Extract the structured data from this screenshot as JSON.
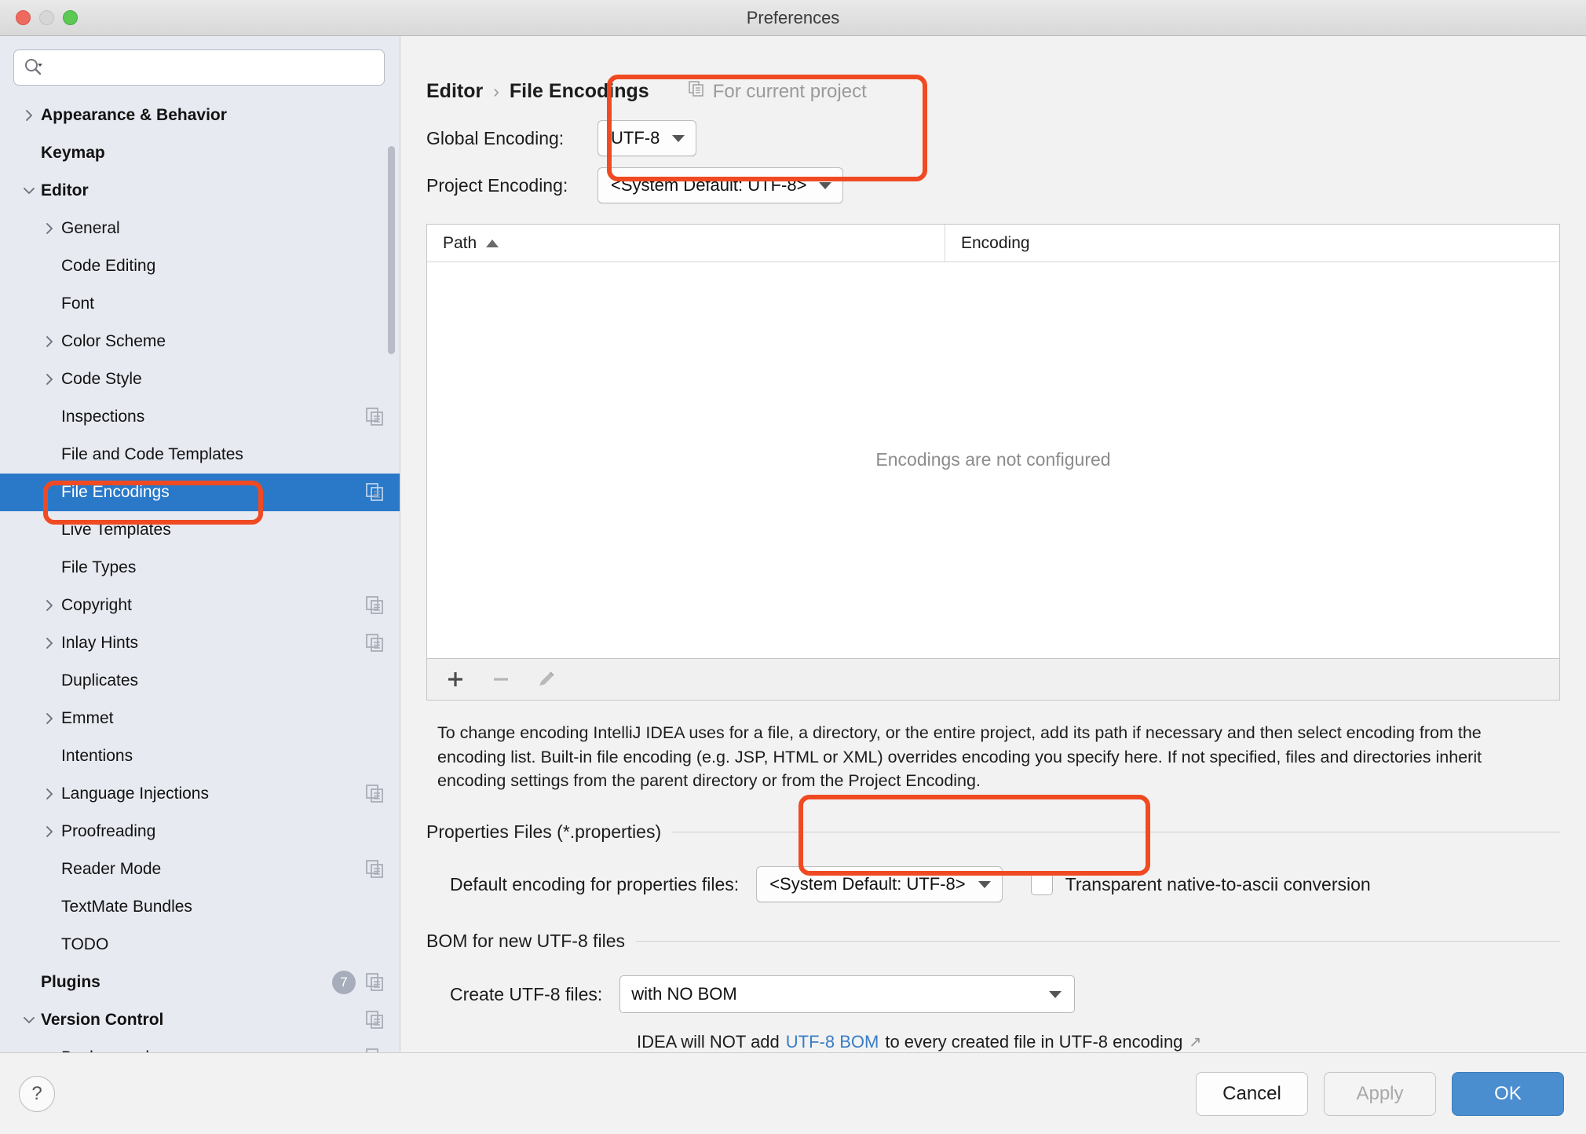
{
  "window": {
    "title": "Preferences"
  },
  "search": {
    "value": "",
    "placeholder": ""
  },
  "sidebar": {
    "items": [
      {
        "label": "Appearance & Behavior",
        "level": 0,
        "chevron": "right",
        "bold": true
      },
      {
        "label": "Keymap",
        "level": 0,
        "chevron": "none",
        "bold": true
      },
      {
        "label": "Editor",
        "level": 0,
        "chevron": "down",
        "bold": true
      },
      {
        "label": "General",
        "level": 1,
        "chevron": "right"
      },
      {
        "label": "Code Editing",
        "level": 1,
        "chevron": "none"
      },
      {
        "label": "Font",
        "level": 1,
        "chevron": "none"
      },
      {
        "label": "Color Scheme",
        "level": 1,
        "chevron": "right"
      },
      {
        "label": "Code Style",
        "level": 1,
        "chevron": "right"
      },
      {
        "label": "Inspections",
        "level": 1,
        "chevron": "none",
        "copy": true
      },
      {
        "label": "File and Code Templates",
        "level": 1,
        "chevron": "none"
      },
      {
        "label": "File Encodings",
        "level": 1,
        "chevron": "none",
        "copy": true,
        "selected": true
      },
      {
        "label": "Live Templates",
        "level": 1,
        "chevron": "none"
      },
      {
        "label": "File Types",
        "level": 1,
        "chevron": "none"
      },
      {
        "label": "Copyright",
        "level": 1,
        "chevron": "right",
        "copy": true
      },
      {
        "label": "Inlay Hints",
        "level": 1,
        "chevron": "right",
        "copy": true
      },
      {
        "label": "Duplicates",
        "level": 1,
        "chevron": "none"
      },
      {
        "label": "Emmet",
        "level": 1,
        "chevron": "right"
      },
      {
        "label": "Intentions",
        "level": 1,
        "chevron": "none"
      },
      {
        "label": "Language Injections",
        "level": 1,
        "chevron": "right",
        "copy": true
      },
      {
        "label": "Proofreading",
        "level": 1,
        "chevron": "right"
      },
      {
        "label": "Reader Mode",
        "level": 1,
        "chevron": "none",
        "copy": true
      },
      {
        "label": "TextMate Bundles",
        "level": 1,
        "chevron": "none"
      },
      {
        "label": "TODO",
        "level": 1,
        "chevron": "none"
      },
      {
        "label": "Plugins",
        "level": 0,
        "chevron": "none",
        "bold": true,
        "badge": "7",
        "copy": true
      },
      {
        "label": "Version Control",
        "level": 0,
        "chevron": "down",
        "bold": true,
        "copy": true
      },
      {
        "label": "Background",
        "level": 1,
        "chevron": "none",
        "copy": true
      }
    ]
  },
  "main": {
    "breadcrumb": {
      "parent": "Editor",
      "separator": "›",
      "current": "File Encodings",
      "note": "For current project"
    },
    "global_encoding": {
      "label": "Global Encoding:",
      "value": "UTF-8"
    },
    "project_encoding": {
      "label": "Project Encoding:",
      "value": "<System Default: UTF-8>"
    },
    "table": {
      "columns": [
        "Path",
        "Encoding"
      ],
      "sort_column": "Path",
      "sort_direction": "asc",
      "rows": [],
      "empty_message": "Encodings are not configured",
      "toolbar": {
        "add": "+",
        "remove": "−",
        "edit": "edit-pencil"
      }
    },
    "description": "To change encoding IntelliJ IDEA uses for a file, a directory, or the entire project, add its path if necessary and then select encoding from the encoding list. Built-in file encoding (e.g. JSP, HTML or XML) overrides encoding you specify here. If not specified, files and directories inherit encoding settings from the parent directory or from the Project Encoding.",
    "properties_section": {
      "title": "Properties Files (*.properties)",
      "default_encoding_label": "Default encoding for properties files:",
      "default_encoding_value": "<System Default: UTF-8>",
      "transparent_label": "Transparent native-to-ascii conversion",
      "transparent_checked": false
    },
    "bom_section": {
      "title": "BOM for new UTF-8 files",
      "create_label": "Create UTF-8 files:",
      "create_value": "with NO BOM",
      "note_prefix": "IDEA will NOT add ",
      "note_link": "UTF-8 BOM",
      "note_suffix": " to every created file in UTF-8 encoding",
      "external_arrow": "↗"
    }
  },
  "footer": {
    "help": "?",
    "cancel": "Cancel",
    "apply": "Apply",
    "ok": "OK"
  },
  "colors": {
    "selection_blue": "#2a78c8",
    "annotation_red": "#f04a23",
    "primary_button": "#4a8ed0",
    "link_blue": "#3a7dc4"
  }
}
